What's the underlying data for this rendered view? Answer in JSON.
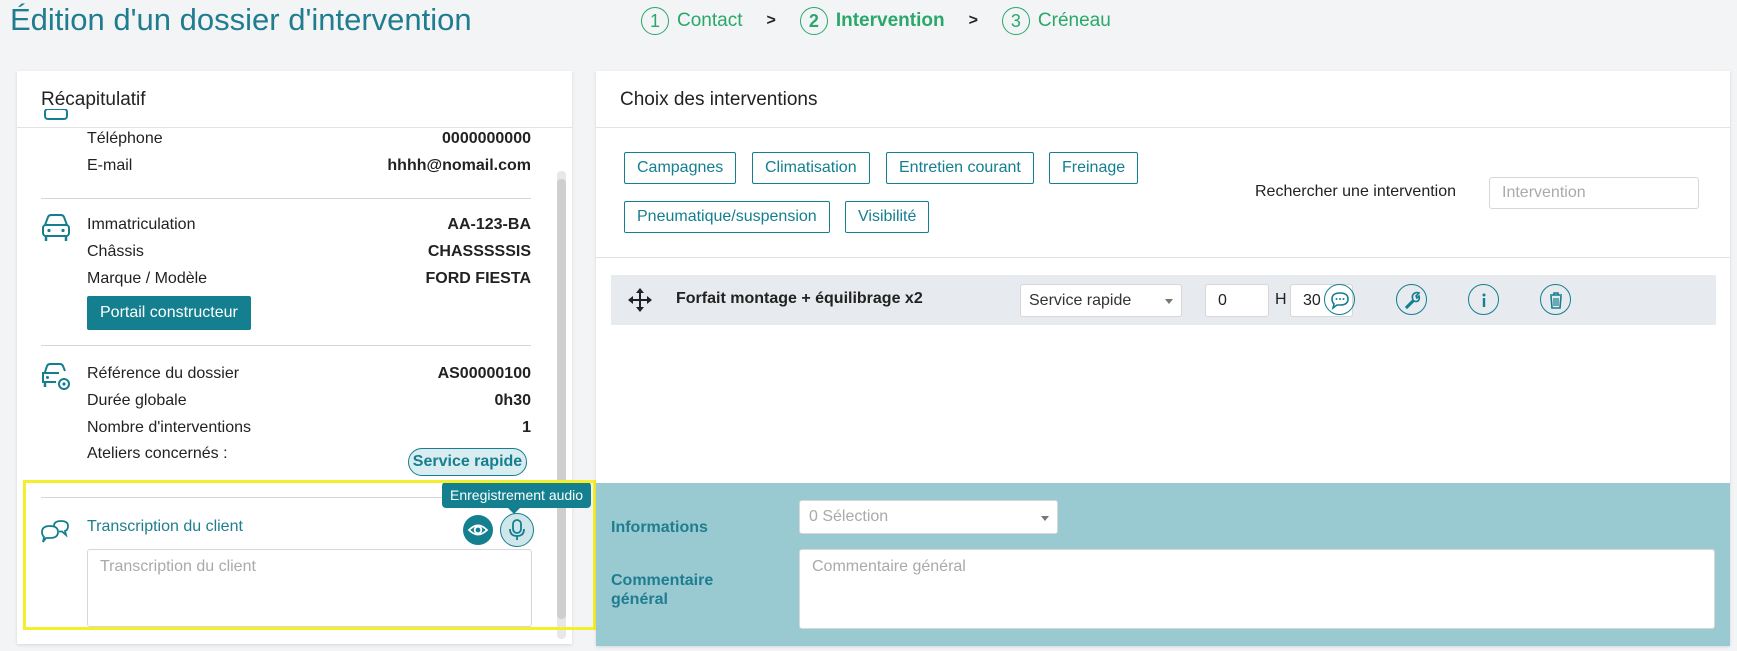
{
  "page": {
    "title": "Édition d'un dossier d'intervention"
  },
  "stepper": {
    "steps": [
      {
        "num": "1",
        "label": "Contact"
      },
      {
        "num": "2",
        "label": "Intervention"
      },
      {
        "num": "3",
        "label": "Créneau"
      }
    ],
    "separator": ">",
    "active_step": 2
  },
  "recap": {
    "title": "Récapitulatif",
    "contact": [
      {
        "label": "Téléphone",
        "value": "0000000000"
      },
      {
        "label": "E-mail",
        "value": "hhhh@nomail.com"
      }
    ],
    "vehicle": [
      {
        "label": "Immatriculation",
        "value": "AA-123-BA"
      },
      {
        "label": "Châssis",
        "value": "CHASSSSSIS"
      },
      {
        "label": "Marque / Modèle",
        "value": "FORD FIESTA"
      }
    ],
    "portail_button": "Portail constructeur",
    "dossier": [
      {
        "label": "Référence du dossier",
        "value": "AS00000100"
      },
      {
        "label": "Durée globale",
        "value": "0h30"
      },
      {
        "label": "Nombre d'interventions",
        "value": "1"
      },
      {
        "label": "Ateliers concernés :",
        "value": ""
      }
    ],
    "atelier_badge": "Service rapide",
    "transcription": {
      "label": "Transcription du client",
      "placeholder": "Transcription du client",
      "tooltip": "Enregistrement audio"
    }
  },
  "interventions": {
    "title": "Choix des interventions",
    "categories": [
      "Campagnes",
      "Climatisation",
      "Entretien courant",
      "Freinage",
      "Pneumatique/suspension",
      "Visibilité"
    ],
    "search": {
      "label": "Rechercher une intervention",
      "placeholder": "Intervention"
    },
    "items": [
      {
        "name": "Forfait montage + équilibrage x2",
        "atelier": "Service rapide",
        "hours": "0",
        "hours_unit": "H",
        "minutes": "30"
      }
    ]
  },
  "bottom": {
    "informations_label": "Informations",
    "informations_select": "0 Sélection",
    "commentaire_label": "Commentaire général",
    "commentaire_placeholder": "Commentaire général"
  },
  "colors": {
    "accent": "#137f8f",
    "stepper": "#2aa86b",
    "bottom_bg": "#99cad2",
    "highlight": "#f3ef2b"
  }
}
